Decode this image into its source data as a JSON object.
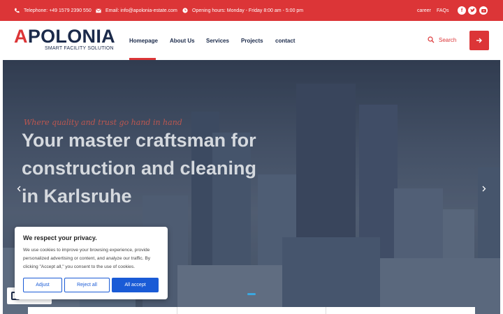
{
  "topbar": {
    "phone": "Telephone: +49 1579 2390 550",
    "email": "Email: info@apolonia-estate.com",
    "hours": "Opening hours: Monday - Friday 8:00 am - 5:00 pm",
    "links": [
      "career",
      "FAQs"
    ],
    "social_icons": [
      "facebook-icon",
      "twitter-icon",
      "youtube-icon"
    ]
  },
  "brand": {
    "name_first": "A",
    "name_rest": "POLONIA",
    "tagline": "SMART FACILITY SOLUTION"
  },
  "nav": {
    "items": [
      "Homepage",
      "About Us",
      "Services",
      "Projects",
      "contact"
    ],
    "active": "Homepage",
    "search_label": "Search"
  },
  "hero": {
    "tagline": "Where quality and trust go hand in hand",
    "headline_lines": [
      "Your master craftsman for",
      "construction and cleaning",
      "in Karlsruhe"
    ]
  },
  "cookie": {
    "title": "We respect your privacy.",
    "text": "We use cookies to improve your browsing experience, provide personalized advertising or content, and analyze our traffic. By clicking \"Accept all,\" you consent to the use of cookies.",
    "adjust": "Adjust",
    "reject": "Reject all",
    "accept": "All accept"
  },
  "colors": {
    "accent": "#dc3537",
    "navy": "#1b2a4a",
    "cookie_blue": "#1a5bd6"
  }
}
